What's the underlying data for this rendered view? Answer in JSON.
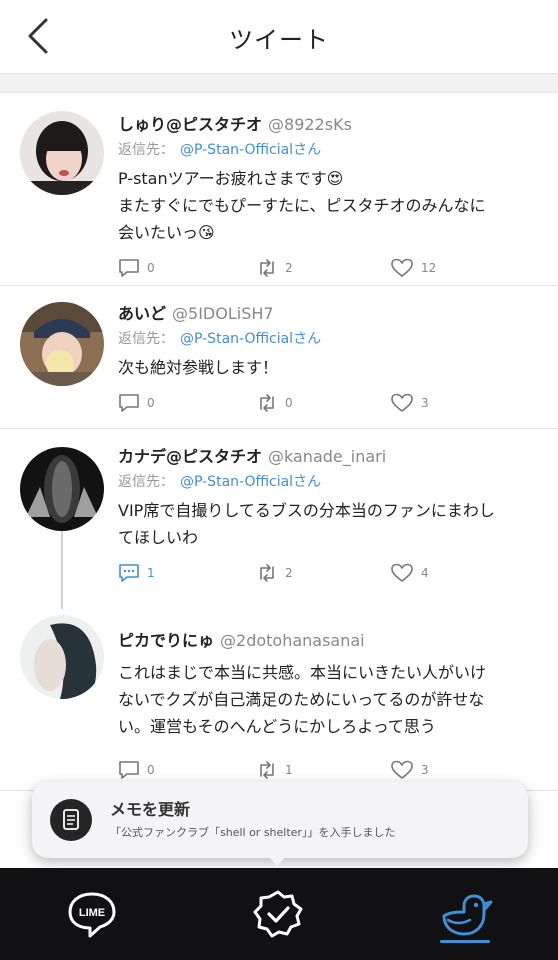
{
  "header": {
    "title": "ツイート",
    "back_icon": "chevron-left-icon"
  },
  "reply_prefix": "返信先：",
  "tweets": [
    {
      "name": "しゅり@ピスタチオ",
      "handle": "@8922sKs",
      "reply_to": "@P-Stan-Officialさん",
      "lines": [
        "P-stanツアーお疲れさまです😍",
        "またすぐにでもぴーすたに、ピスタチオのみんなに",
        "会いたいっ😘"
      ],
      "replies": "0",
      "retweets": "2",
      "likes": "12"
    },
    {
      "name": "あいど",
      "handle": "@5IDOLiSH7",
      "reply_to": "@P-Stan-Officialさん",
      "lines": [
        "次も絶対参戦します！"
      ],
      "replies": "0",
      "retweets": "0",
      "likes": "3"
    },
    {
      "name": "カナデ@ピスタチオ",
      "handle": "@kanade_inari",
      "reply_to": "@P-Stan-Officialさん",
      "lines": [
        "VIP席で自撮りしてるブスの分本当のファンにまわし",
        "てほしいわ"
      ],
      "replies": "1",
      "retweets": "2",
      "likes": "4"
    },
    {
      "name": "ピカでりにゅ",
      "handle": "@2dotohanasanai",
      "lines": [
        "これはまじで本当に共感。本当にいきたい人がいけ",
        "ないでクズが自己満足のためにいってるのが許せな",
        "い。運営もそのへんどうにかしろよって思う"
      ],
      "replies": "0",
      "retweets": "1",
      "likes": "3"
    }
  ],
  "toast": {
    "title": "メモを更新",
    "subtitle": "「公式ファンクラブ「shell or shelter」」を入手しました",
    "icon": "memo-icon"
  },
  "bottom_nav": {
    "items": [
      {
        "label": "LIME",
        "icon": "lime-chat-icon"
      },
      {
        "label": "",
        "icon": "badge-check-icon"
      },
      {
        "label": "",
        "icon": "bird-icon"
      }
    ],
    "active_index": 2,
    "accent": "#3f8fd9"
  }
}
